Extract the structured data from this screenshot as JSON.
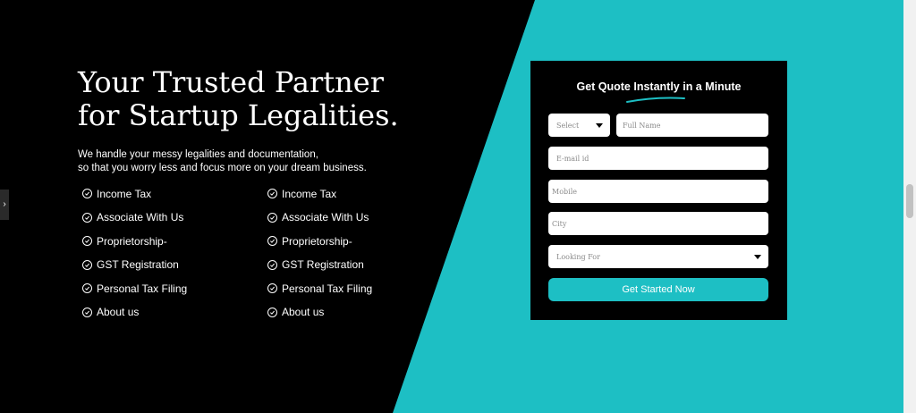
{
  "hero": {
    "title_line1": "Your Trusted Partner",
    "title_line2": "for Startup Legalities.",
    "subtitle_line1": "We handle your messy legalities and documentation,",
    "subtitle_line2": "so that you worry less and focus more on your dream business."
  },
  "links": [
    "Income Tax",
    "Income Tax",
    "Associate With Us",
    "Associate With Us",
    "Proprietorship-",
    "Proprietorship-",
    "GST Registration",
    "GST Registration",
    "Personal Tax Filing",
    "Personal Tax Filing",
    "About us",
    "About us"
  ],
  "form": {
    "title": "Get Quote Instantly in a Minute",
    "select_label": "Select",
    "full_name_placeholder": "Full Name",
    "email_placeholder": "E-mail id",
    "mobile_placeholder": "Mobile",
    "city_placeholder": "City",
    "looking_for_label": "Looking For",
    "submit_label": "Get Started Now"
  },
  "colors": {
    "accent": "#1dbfc4",
    "dark": "#000000"
  },
  "side_tab_icon": "chevron-right-icon"
}
